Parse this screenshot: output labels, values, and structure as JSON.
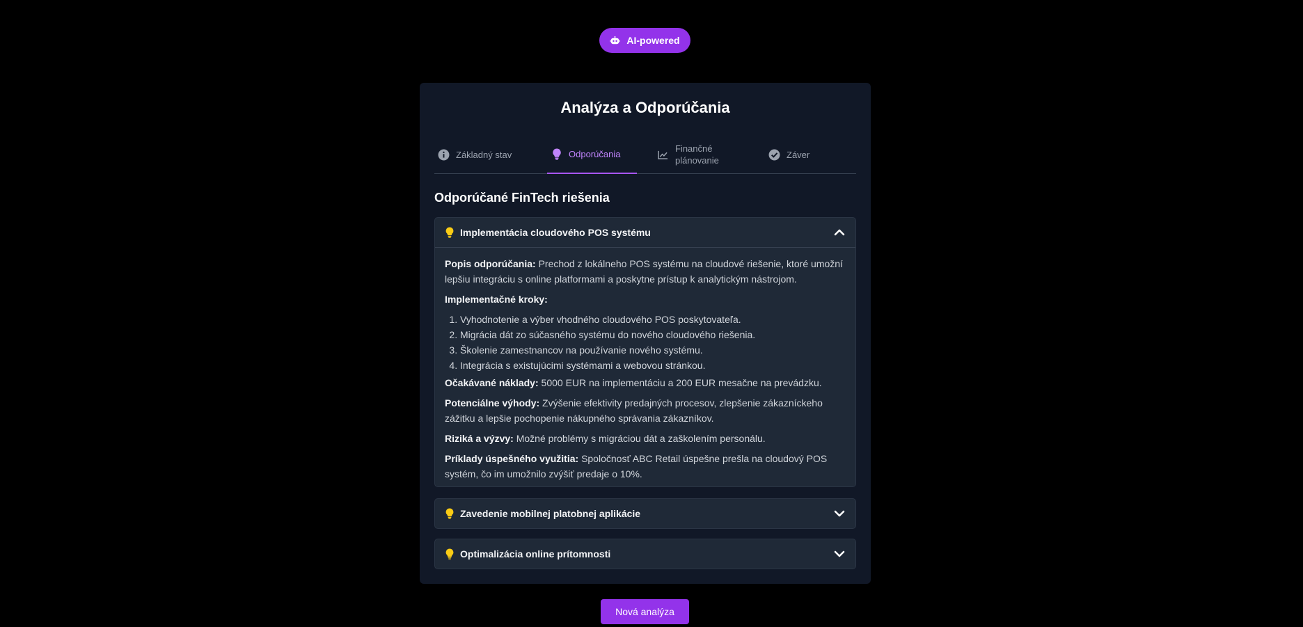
{
  "badge": {
    "label": "AI-powered",
    "icon": "robot-icon"
  },
  "card": {
    "title": "Analýza a Odporúčania"
  },
  "tabs": [
    {
      "label": "Základný stav",
      "icon": "info-circle-icon",
      "active": false
    },
    {
      "label": "Odporúčania",
      "icon": "lightbulb-icon",
      "active": true
    },
    {
      "label": "Finančné plánovanie",
      "icon": "chart-line-icon",
      "active": false
    },
    {
      "label": "Záver",
      "icon": "check-circle-icon",
      "active": false
    }
  ],
  "section": {
    "title": "Odporúčané FinTech riešenia"
  },
  "recommendations": [
    {
      "title": "Implementácia cloudového POS systému",
      "expanded": true,
      "description_label": "Popis odporúčania:",
      "description": "Prechod z lokálneho POS systému na cloudové riešenie, ktoré umožní lepšiu integráciu s online platformami a poskytne prístup k analytickým nástrojom.",
      "steps_label": "Implementačné kroky:",
      "steps": [
        "Vyhodnotenie a výber vhodného cloudového POS poskytovateľa.",
        "Migrácia dát zo súčasného systému do nového cloudového riešenia.",
        "Školenie zamestnancov na používanie nového systému.",
        "Integrácia s existujúcimi systémami a webovou stránkou."
      ],
      "costs_label": "Očakávané náklady:",
      "costs": "5000 EUR na implementáciu a 200 EUR mesačne na prevádzku.",
      "benefits_label": "Potenciálne výhody:",
      "benefits": "Zvýšenie efektivity predajných procesov, zlepšenie zákazníckeho zážitku a lepšie pochopenie nákupného správania zákazníkov.",
      "risks_label": "Riziká a výzvy:",
      "risks": "Možné problémy s migráciou dát a zaškolením personálu.",
      "examples_label": "Príklady úspešného využitia:",
      "examples": "Spoločnosť ABC Retail úspešne prešla na cloudový POS systém, čo im umožnilo zvýšiť predaje o 10%."
    },
    {
      "title": "Zavedenie mobilnej platobnej aplikácie",
      "expanded": false
    },
    {
      "title": "Optimalizácia online prítomnosti",
      "expanded": false
    }
  ],
  "actions": {
    "new_analysis": "Nová analýza"
  },
  "colors": {
    "accent": "#9333ea",
    "accent_text": "#c084fc",
    "bulb": "#facc15",
    "card_bg": "#111827",
    "panel_bg": "#1f2937"
  }
}
